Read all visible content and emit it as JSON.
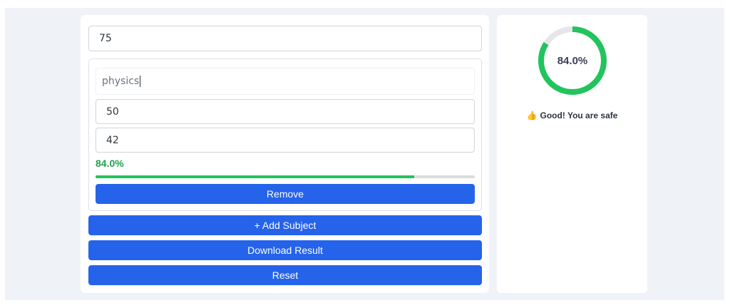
{
  "form": {
    "total_value": "75"
  },
  "subject": {
    "name_value": "physics",
    "max_marks_value": "50",
    "obtained_value": "42",
    "percentage_text": "84.0%",
    "progress_percent": 84.0,
    "remove_label": "Remove"
  },
  "actions": {
    "add_label": "+ Add Subject",
    "download_label": "Download Result",
    "reset_label": "Reset"
  },
  "summary": {
    "ring_percent_value": 84.0,
    "ring_label": "84.0%",
    "status_icon": "thumbs-up-icon",
    "status_text": "Good! You are safe"
  },
  "colors": {
    "accent": "#2563eb",
    "success": "#21c45d",
    "success_text": "#1ea34a",
    "track": "#dcdcdc"
  }
}
